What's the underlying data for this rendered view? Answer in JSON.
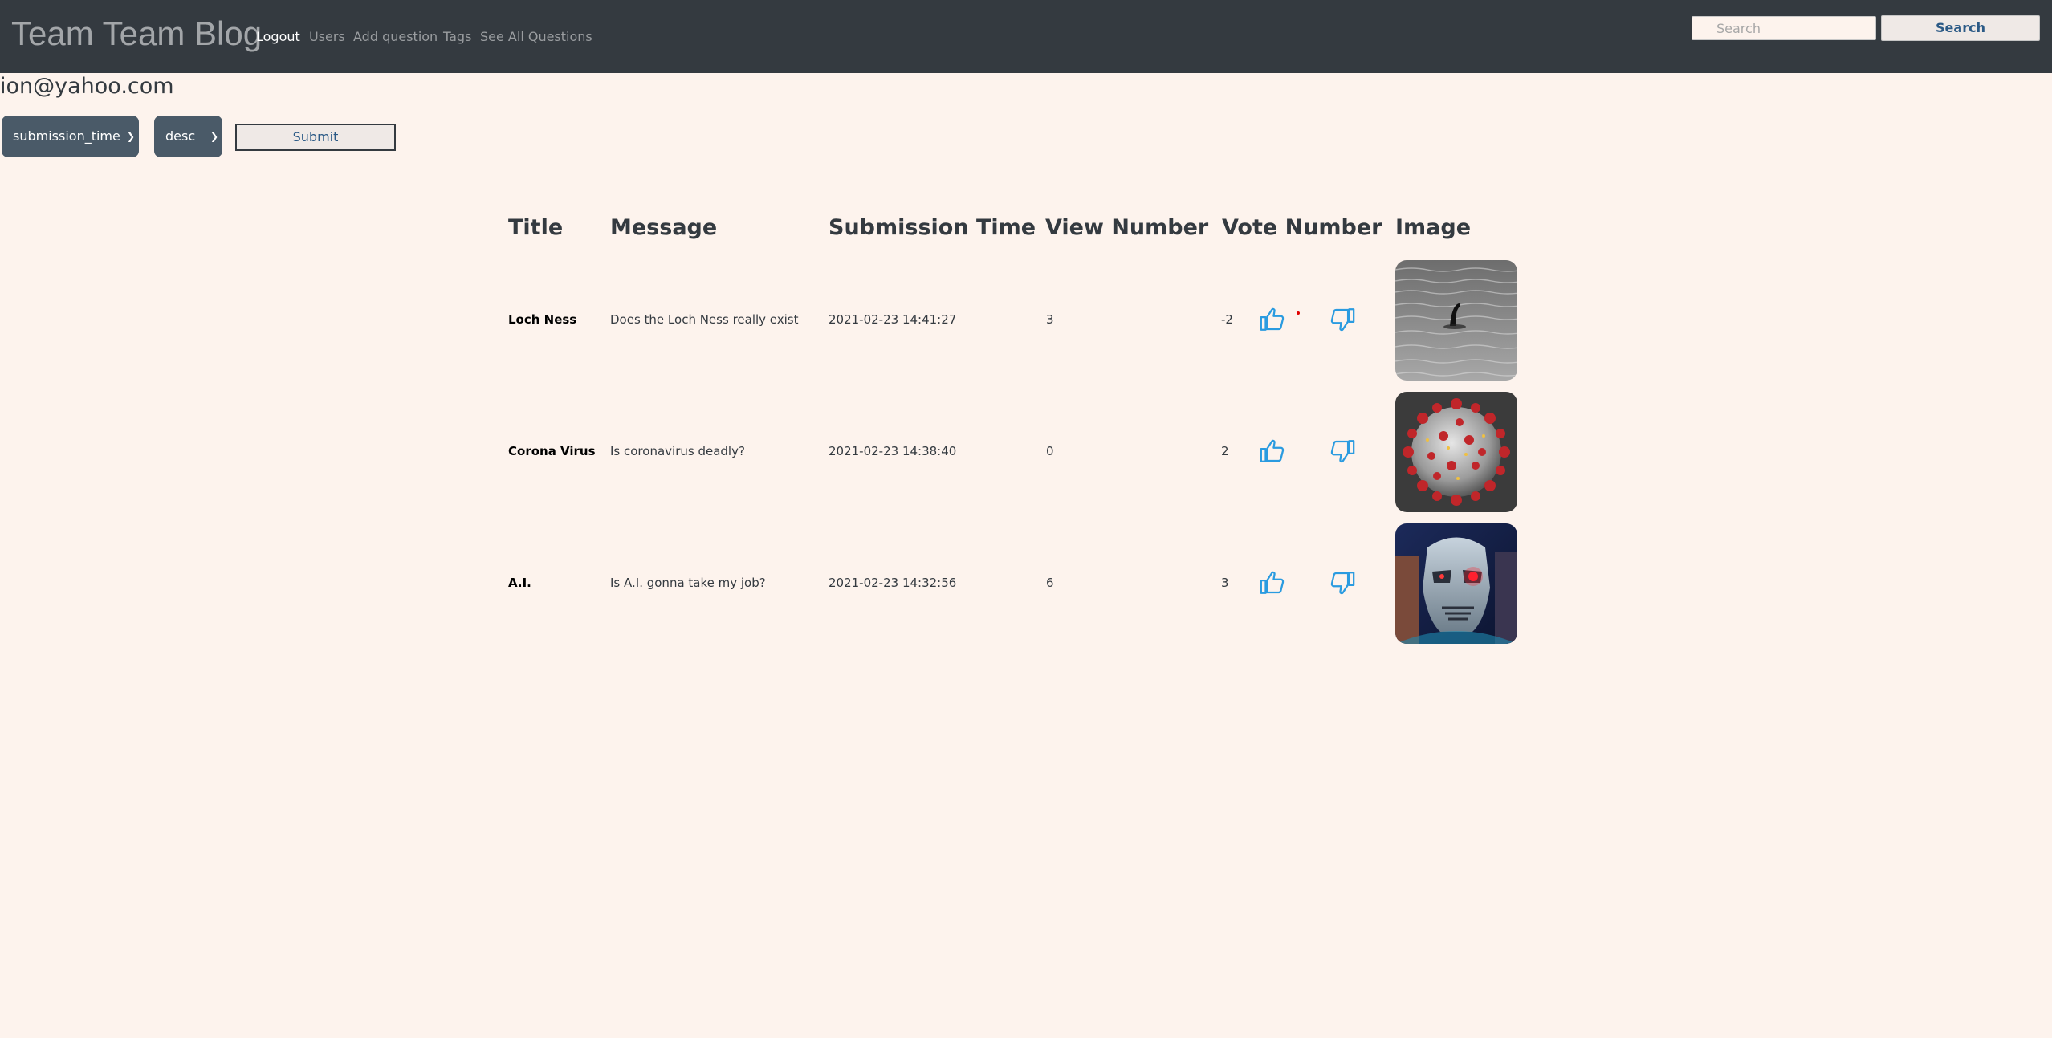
{
  "navbar": {
    "brand": "Team Team Blog",
    "links": [
      {
        "label": "Logout",
        "active": true
      },
      {
        "label": "Users"
      },
      {
        "label": "Add question"
      },
      {
        "label": "Tags"
      },
      {
        "label": "See All Questions"
      }
    ],
    "search": {
      "placeholder": "Search",
      "button_label": "Search"
    }
  },
  "user": {
    "email": "ion@yahoo.com"
  },
  "sort": {
    "field": "submission_time",
    "order": "desc",
    "submit_label": "Submit"
  },
  "table": {
    "headers": [
      "Title",
      "Message",
      "Submission Time",
      "View Number",
      "Vote Number",
      "Image"
    ],
    "rows": [
      {
        "title": "Loch Ness",
        "message": "Does the Loch Ness really exist",
        "submission_time": "2021-02-23 14:41:27",
        "view_number": "3",
        "vote_number": "-2",
        "image": "loch-ness-monster-photo"
      },
      {
        "title": "Corona Virus",
        "message": "Is coronavirus deadly?",
        "submission_time": "2021-02-23 14:38:40",
        "view_number": "0",
        "vote_number": "2",
        "image": "coronavirus-illustration"
      },
      {
        "title": "A.I.",
        "message": "Is A.I. gonna take my job?",
        "submission_time": "2021-02-23 14:32:56",
        "view_number": "6",
        "vote_number": "3",
        "image": "terminator-robot-photo"
      }
    ]
  },
  "icons": {
    "upvote": "thumbs-up-icon",
    "downvote": "thumbs-down-icon"
  },
  "colors": {
    "navbar": "#343a40",
    "background": "#fdf3ed",
    "select": "#4a5a68",
    "vote_icon": "#2a9be0"
  }
}
